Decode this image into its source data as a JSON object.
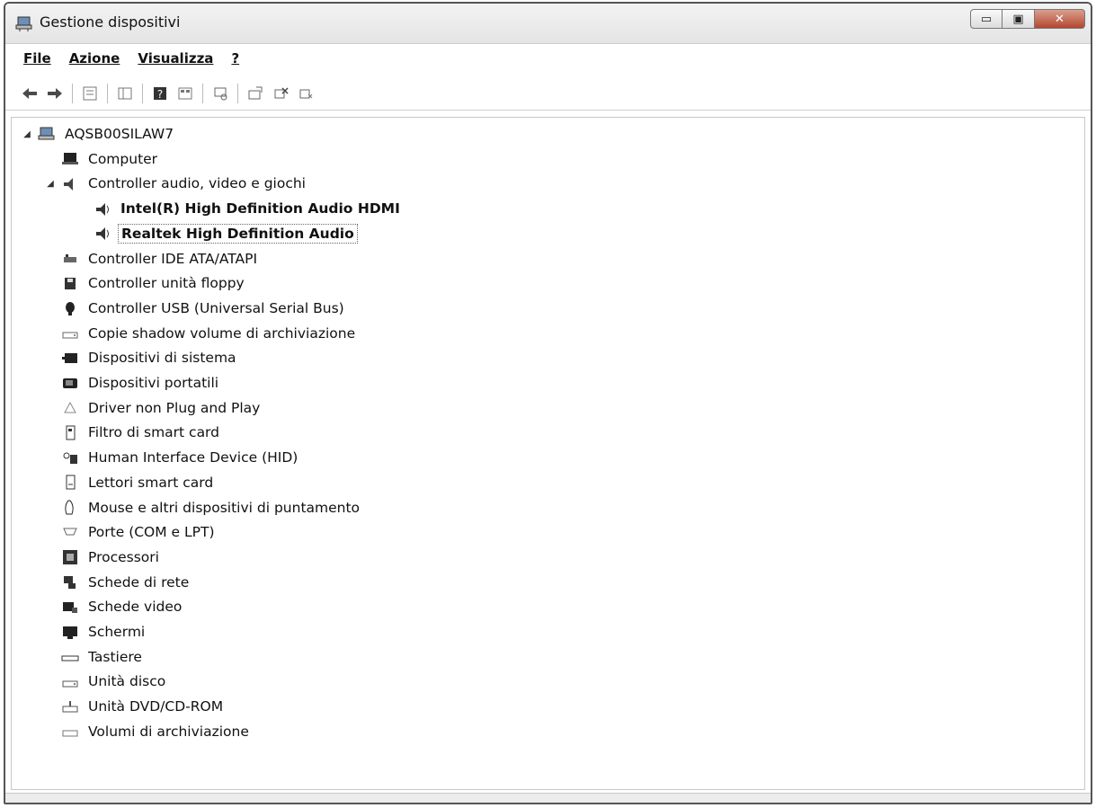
{
  "window": {
    "title": "Gestione dispositivi",
    "min_label": "▭",
    "max_label": "▣",
    "close_label": "✕"
  },
  "menu": {
    "items": [
      {
        "label": "File"
      },
      {
        "label": "Azione"
      },
      {
        "label": "Visualizza"
      },
      {
        "label": "?"
      }
    ]
  },
  "toolbar": {
    "buttons": [
      {
        "icon": "back-arrow-icon"
      },
      {
        "icon": "forward-arrow-icon"
      },
      {
        "icon": "properties-icon"
      },
      {
        "icon": "show-hide-tree-icon"
      },
      {
        "icon": "help-icon"
      },
      {
        "icon": "view-icon"
      },
      {
        "icon": "scan-hardware-icon"
      },
      {
        "icon": "update-driver-icon"
      },
      {
        "icon": "uninstall-icon"
      },
      {
        "icon": "disable-device-icon"
      }
    ]
  },
  "tree": {
    "root": {
      "label": "AQSB00SILAW7",
      "expanded": true
    },
    "nodes": [
      {
        "label": "Computer",
        "level": 1,
        "icon": "computer-icon"
      },
      {
        "label": "Controller audio, video e giochi",
        "level": 1,
        "expanded": true,
        "icon": "audio-icon"
      },
      {
        "label": "Intel(R) High Definition Audio HDMI",
        "level": 2,
        "bold": true,
        "icon": "speaker-icon"
      },
      {
        "label": "Realtek High Definition Audio",
        "level": 2,
        "bold": true,
        "selected": true,
        "icon": "speaker-icon"
      },
      {
        "label": "Controller IDE ATA/ATAPI",
        "level": 1,
        "icon": "ide-controller-icon"
      },
      {
        "label": "Controller unità floppy",
        "level": 1,
        "icon": "floppy-controller-icon"
      },
      {
        "label": "Controller USB (Universal Serial Bus)",
        "level": 1,
        "icon": "usb-icon"
      },
      {
        "label": "Copie shadow volume di archiviazione",
        "level": 1,
        "icon": "drive-icon"
      },
      {
        "label": "Dispositivi di sistema",
        "level": 1,
        "icon": "system-device-icon"
      },
      {
        "label": "Dispositivi portatili",
        "level": 1,
        "icon": "portable-device-icon"
      },
      {
        "label": "Driver non Plug and Play",
        "level": 1,
        "icon": "driver-icon"
      },
      {
        "label": "Filtro di smart card",
        "level": 1,
        "icon": "smart-card-icon"
      },
      {
        "label": "Human Interface Device (HID)",
        "level": 1,
        "icon": "hid-icon"
      },
      {
        "label": "Lettori smart card",
        "level": 1,
        "icon": "smart-card-reader-icon"
      },
      {
        "label": "Mouse e altri dispositivi di puntamento",
        "level": 1,
        "icon": "mouse-icon"
      },
      {
        "label": "Porte (COM e LPT)",
        "level": 1,
        "icon": "port-icon"
      },
      {
        "label": "Processori",
        "level": 1,
        "icon": "processor-icon"
      },
      {
        "label": "Schede di rete",
        "level": 1,
        "icon": "network-adapter-icon"
      },
      {
        "label": "Schede video",
        "level": 1,
        "icon": "display-adapter-icon"
      },
      {
        "label": "Schermi",
        "level": 1,
        "icon": "monitor-icon"
      },
      {
        "label": "Tastiere",
        "level": 1,
        "icon": "keyboard-icon"
      },
      {
        "label": "Unità disco",
        "level": 1,
        "icon": "disk-drive-icon"
      },
      {
        "label": "Unità DVD/CD-ROM",
        "level": 1,
        "icon": "dvd-drive-icon"
      },
      {
        "label": "Volumi di archiviazione",
        "level": 1,
        "icon": "storage-volume-icon"
      }
    ]
  }
}
